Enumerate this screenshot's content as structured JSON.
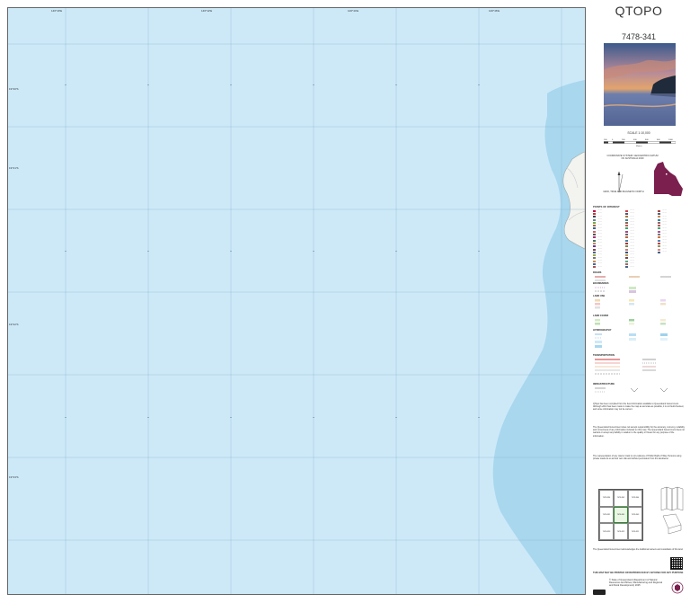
{
  "title": "QTOPO",
  "map_number": "7478-341",
  "scale": "SCALE 1:10,000",
  "scale_bar_labels": [
    "100",
    "0",
    "200",
    "400",
    "600",
    "800",
    "1000"
  ],
  "scale_units": "Metres",
  "grid_coords": {
    "top": [
      "146°40'E",
      "146°42'E",
      "146°44'E",
      "146°46'E"
    ],
    "left": [
      "19°20'S",
      "19°21'S",
      "19°22'S",
      "19°23'S"
    ]
  },
  "projection_text": "COORDINATE SYSTEM: GEOCENTRIC DATUM OF AUSTRALIA 2020",
  "north_text": "GRID, TRUE AND MAGNETIC NORTH",
  "legend_heading": "POINTS OF INTEREST",
  "legend_sections": [
    "ROADS",
    "BOUNDARIES",
    "LAND USE",
    "LAND COVER",
    "HYDROGRAPHY",
    "TRANSPORTATION",
    "INFRASTRUCTURE"
  ],
  "disclaimer": [
    "QTopo has been compiled from the best information available to Queensland Government. Although effort has been made to make the map as accurate as possible, it is not field checked, and some information may not be current.",
    "The Queensland Government does not accept responsibility for the accuracy, currency, reliability and correctness of any information included on this map. The Queensland Government does not warrant or accept any liability in relation to the quality or fitness for any purpose of the information.",
    "The representation of any road or track is not evidence of Public Right of Way. Persons using private roads do so at their own risk and without permission from the landowner.",
    "The Queensland Government acknowledges the traditional owners and custodians of this land."
  ],
  "index_labels": [
    "7478-334",
    "7478-342",
    "7478-344",
    "7478-331",
    "7478-341",
    "7478-343",
    "7478-323",
    "7478-322",
    "7478-321"
  ],
  "bottom_note": "THIS MAP MAY BE PRINTED OR REPRODUCED BY ANYONE FOR ANY PURPOSE",
  "copyright": "© State of Queensland (Department of Natural Resources and Mines, Manufacturing and Regional and Rural Development) 2025",
  "colors": {
    "water": "#cde9f8",
    "deep_water": "#9fd2ee",
    "land": "#f2f4ee",
    "legend_purple": "#7a1f4e",
    "brand": "#333333"
  }
}
